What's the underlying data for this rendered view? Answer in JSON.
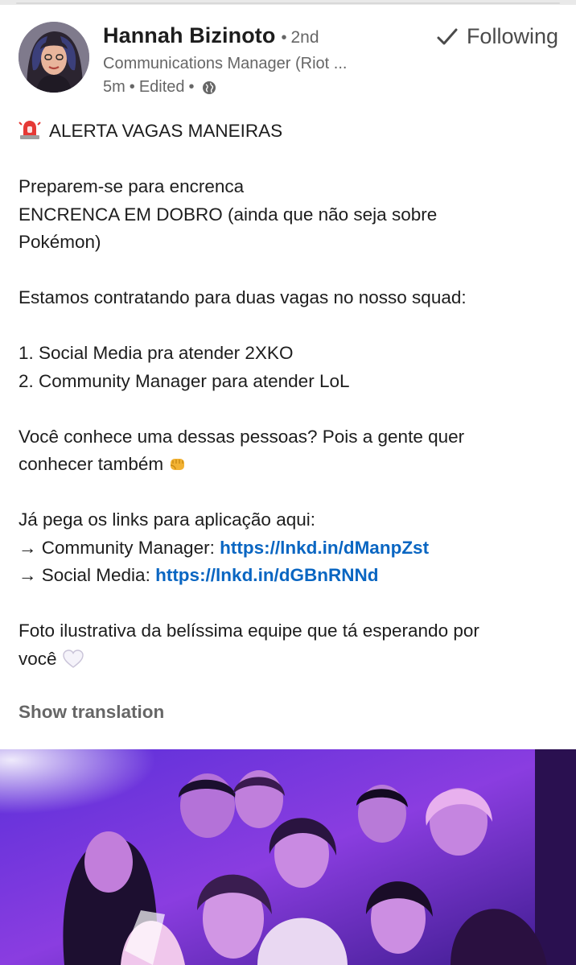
{
  "author": {
    "name": "Hannah Bizinoto",
    "degree": "2nd",
    "headline": "Communications Manager (Riot ...",
    "time": "5m",
    "edited": "Edited",
    "visibility_icon": "globe-icon"
  },
  "follow": {
    "label": "Following",
    "icon": "check-icon"
  },
  "post": {
    "alert_title": "ALERTA VAGAS MANEIRAS",
    "p1_l1": "Preparem-se para encrenca",
    "p1_l2": "ENCRENCA EM DOBRO (ainda que não seja sobre",
    "p1_l3": "Pokémon)",
    "p2": "Estamos contratando para duas vagas no nosso squad:",
    "list": [
      "1. Social Media pra atender 2XKO",
      "2. Community Manager para atender LoL"
    ],
    "p3_l1": "Você conhece uma dessas pessoas? Pois a gente quer",
    "p3_l2": "conhecer também",
    "p4": "Já pega os links para aplicação aqui:",
    "link1_label": "→ Community Manager: ",
    "link1_url": "https://lnkd.in/dManpZst",
    "link2_label": "→ Social Media: ",
    "link2_url": "https://lnkd.in/dGBnRNNd",
    "p5_l1": "Foto ilustrativa da belíssima equipe que tá esperando por",
    "p5_l2": "você"
  },
  "show_translation": "Show translation",
  "colors": {
    "link": "#0a66c2",
    "muted_text": "#666666",
    "photo_tint": "#7a2fd6"
  }
}
